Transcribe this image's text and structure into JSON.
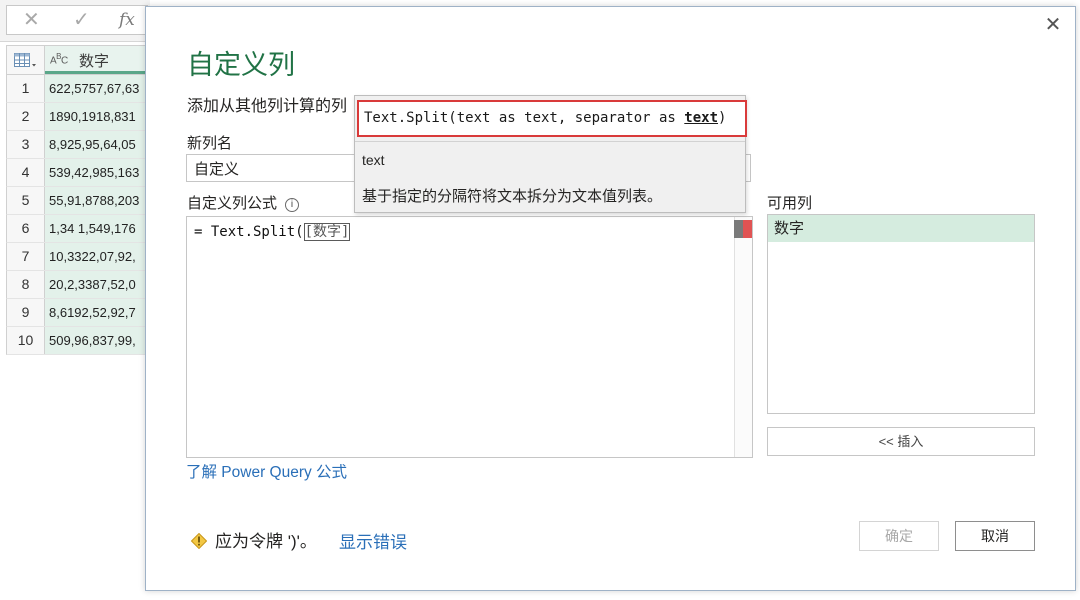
{
  "formula_bar": {
    "fx_label": "fx"
  },
  "grid": {
    "column_header": "数字",
    "type_label": "ABC",
    "rows": [
      {
        "num": "1",
        "value": "622,5757,67,63"
      },
      {
        "num": "2",
        "value": "1890,1918,831"
      },
      {
        "num": "3",
        "value": "8,925,95,64,05"
      },
      {
        "num": "4",
        "value": "539,42,985,163"
      },
      {
        "num": "5",
        "value": "55,91,8788,203"
      },
      {
        "num": "6",
        "value": "1,34 1,549,176"
      },
      {
        "num": "7",
        "value": "10,3322,07,92,"
      },
      {
        "num": "8",
        "value": "20,2,3387,52,0"
      },
      {
        "num": "9",
        "value": "8,6192,52,92,7"
      },
      {
        "num": "10",
        "value": "509,96,837,99,"
      }
    ],
    "colors": {
      "column_fill": "#e3f1ea",
      "header_underline": "#5aa789"
    }
  },
  "dialog": {
    "title": "自定义列",
    "subtitle": "添加从其他列计算的列",
    "new_column_label": "新列名",
    "new_column_value": "自定义",
    "formula_label": "自定义列公式",
    "formula_prefix": "= Text.Split(",
    "formula_token": "[数字]",
    "available_label": "可用列",
    "available_columns": [
      "数字"
    ],
    "insert_label": "<< 插入",
    "learn_link": "了解 Power Query 公式",
    "warning_text": "应为令牌 ')'。",
    "show_errors_link": "显示错误",
    "ok_label": "确定",
    "cancel_label": "取消",
    "close_icon": "close-icon",
    "colors": {
      "title": "#217346",
      "link": "#2a6fb8",
      "selected_item": "#d5ecdf"
    }
  },
  "tooltip": {
    "signature_prefix": "Text.Split(text as text, separator as ",
    "signature_bold": "text",
    "signature_suffix": ")",
    "param_name": "text",
    "description": "基于指定的分隔符将文本拆分为文本值列表。",
    "highlight_color": "#d93a3a"
  }
}
